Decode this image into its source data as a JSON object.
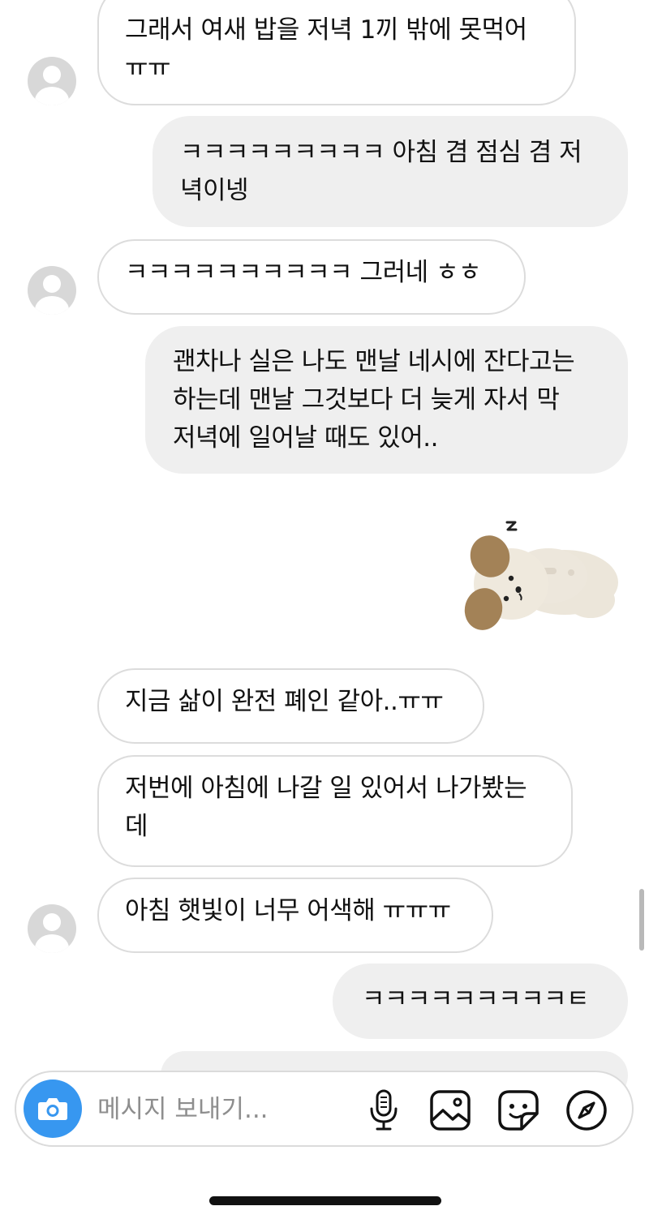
{
  "thread": {
    "msg1": "그래서 여새 밥을 저녁 1끼 밖에 못먹어\nㅠㅠ",
    "msg2": "ㅋㅋㅋㅋㅋㅋㅋㅋㅋ 아침 겸 점심 겸 저\n녁이넹",
    "msg3": "ㅋㅋㅋㅋㅋㅋㅋㅋㅋㅋ 그러네 ㅎㅎ",
    "msg4": "괜차나 실은 나도 맨날 네시에 잔다고는\n하는데 맨날 그것보다 더 늦게 자서 막\n저녁에 일어날 때도 있어..",
    "sticker": "sleeping-puppy-sticker",
    "msg5": "지금 삶이 완전 폐인 같아..ㅠㅠ",
    "msg6": "저번에 아침에 나갈 일 있어서 나가봤는\n데",
    "msg7": "아침 햇빛이 너무 어색해 ㅠㅠㅠ",
    "msg8": "ㅋㅋㅋㅋㅋㅋㅋㅋㅋㅌ"
  },
  "composer": {
    "placeholder": "메시지 보내기...",
    "icons": [
      "camera-icon",
      "microphone-icon",
      "gallery-icon",
      "sticker-icon",
      "explore-icon"
    ]
  },
  "colors": {
    "accent": "#3797f0",
    "sent_bubble": "#efefef",
    "received_border": "#dcdcdc",
    "avatar": "#d8d8d8",
    "placeholder_text": "#8e8e8e"
  }
}
